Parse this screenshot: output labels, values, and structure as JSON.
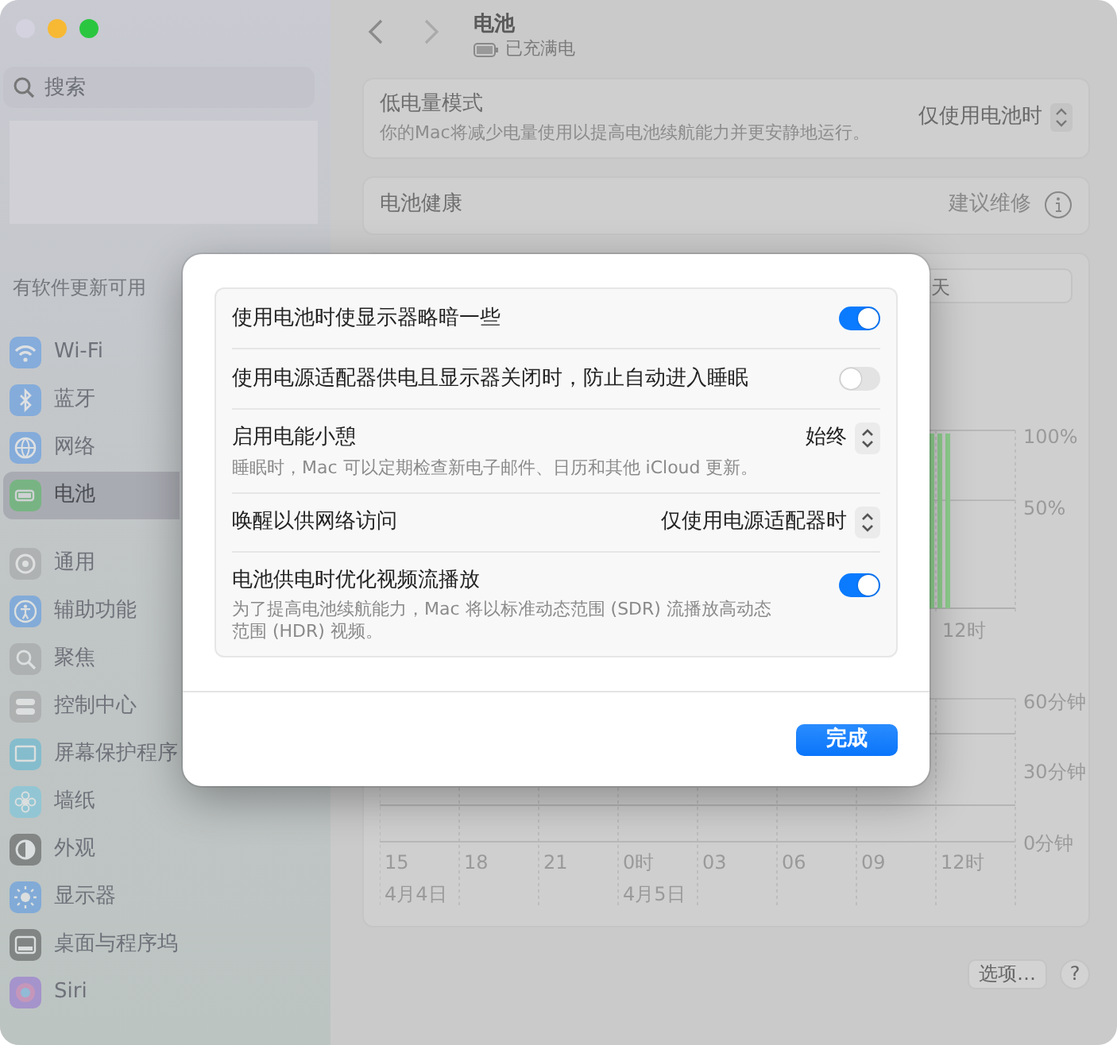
{
  "sidebar": {
    "search_placeholder": "搜索",
    "notice": "有软件更新可用",
    "groups": [
      [
        {
          "label": "Wi-Fi",
          "selected": false
        },
        {
          "label": "蓝牙",
          "selected": false
        },
        {
          "label": "网络",
          "selected": false
        },
        {
          "label": "电池",
          "selected": true
        }
      ],
      [
        {
          "label": "通用",
          "selected": false
        },
        {
          "label": "辅助功能",
          "selected": false
        },
        {
          "label": "聚焦",
          "selected": false
        },
        {
          "label": "控制中心",
          "selected": false
        },
        {
          "label": "屏幕保护程序",
          "selected": false
        },
        {
          "label": "墙纸",
          "selected": false
        },
        {
          "label": "外观",
          "selected": false
        },
        {
          "label": "显示器",
          "selected": false
        },
        {
          "label": "桌面与程序坞",
          "selected": false
        },
        {
          "label": "Siri",
          "selected": false
        }
      ]
    ]
  },
  "header": {
    "title": "电池",
    "subtitle": "已充满电"
  },
  "low_power": {
    "label": "低电量模式",
    "description": "你的Mac将减少电量使用以提高电池续航能力并更安静地运行。",
    "value": "仅使用电池时"
  },
  "battery_health": {
    "label": "电池健康",
    "value": "建议维修"
  },
  "range_segment": "天",
  "level_chart": {
    "y_labels": [
      "100%",
      "50%"
    ],
    "x_labels": [
      "12时"
    ]
  },
  "screen_chart": {
    "y_labels": [
      "60分钟",
      "30分钟",
      "0分钟"
    ],
    "x_labels": [
      {
        "label": "15",
        "date": "4月4日"
      },
      {
        "label": "18"
      },
      {
        "label": "21"
      },
      {
        "label": "0时",
        "date": "4月5日"
      },
      {
        "label": "03"
      },
      {
        "label": "06"
      },
      {
        "label": "09"
      },
      {
        "label": "12时"
      }
    ]
  },
  "footer_buttons": [
    "选项…",
    "?"
  ],
  "dialog": {
    "rows": [
      {
        "kind": "toggle",
        "label": "使用电池时使显示器略暗一些",
        "on": true
      },
      {
        "kind": "toggle",
        "label": "使用电源适配器供电且显示器关闭时，防止自动进入睡眠",
        "on": false
      },
      {
        "kind": "popup",
        "label": "启用电能小憩",
        "description": "睡眠时，Mac 可以定期检查新电子邮件、日历和其他 iCloud 更新。",
        "value": "始终"
      },
      {
        "kind": "popup",
        "label": "唤醒以供网络访问",
        "value": "仅使用电源适配器时"
      },
      {
        "kind": "toggle",
        "label": "电池供电时优化视频流播放",
        "description": "为了提高电池续航能力，Mac 将以标准动态范围 (SDR) 流播放高动态范围 (HDR) 视频。",
        "on": true
      }
    ],
    "button": "完成"
  }
}
